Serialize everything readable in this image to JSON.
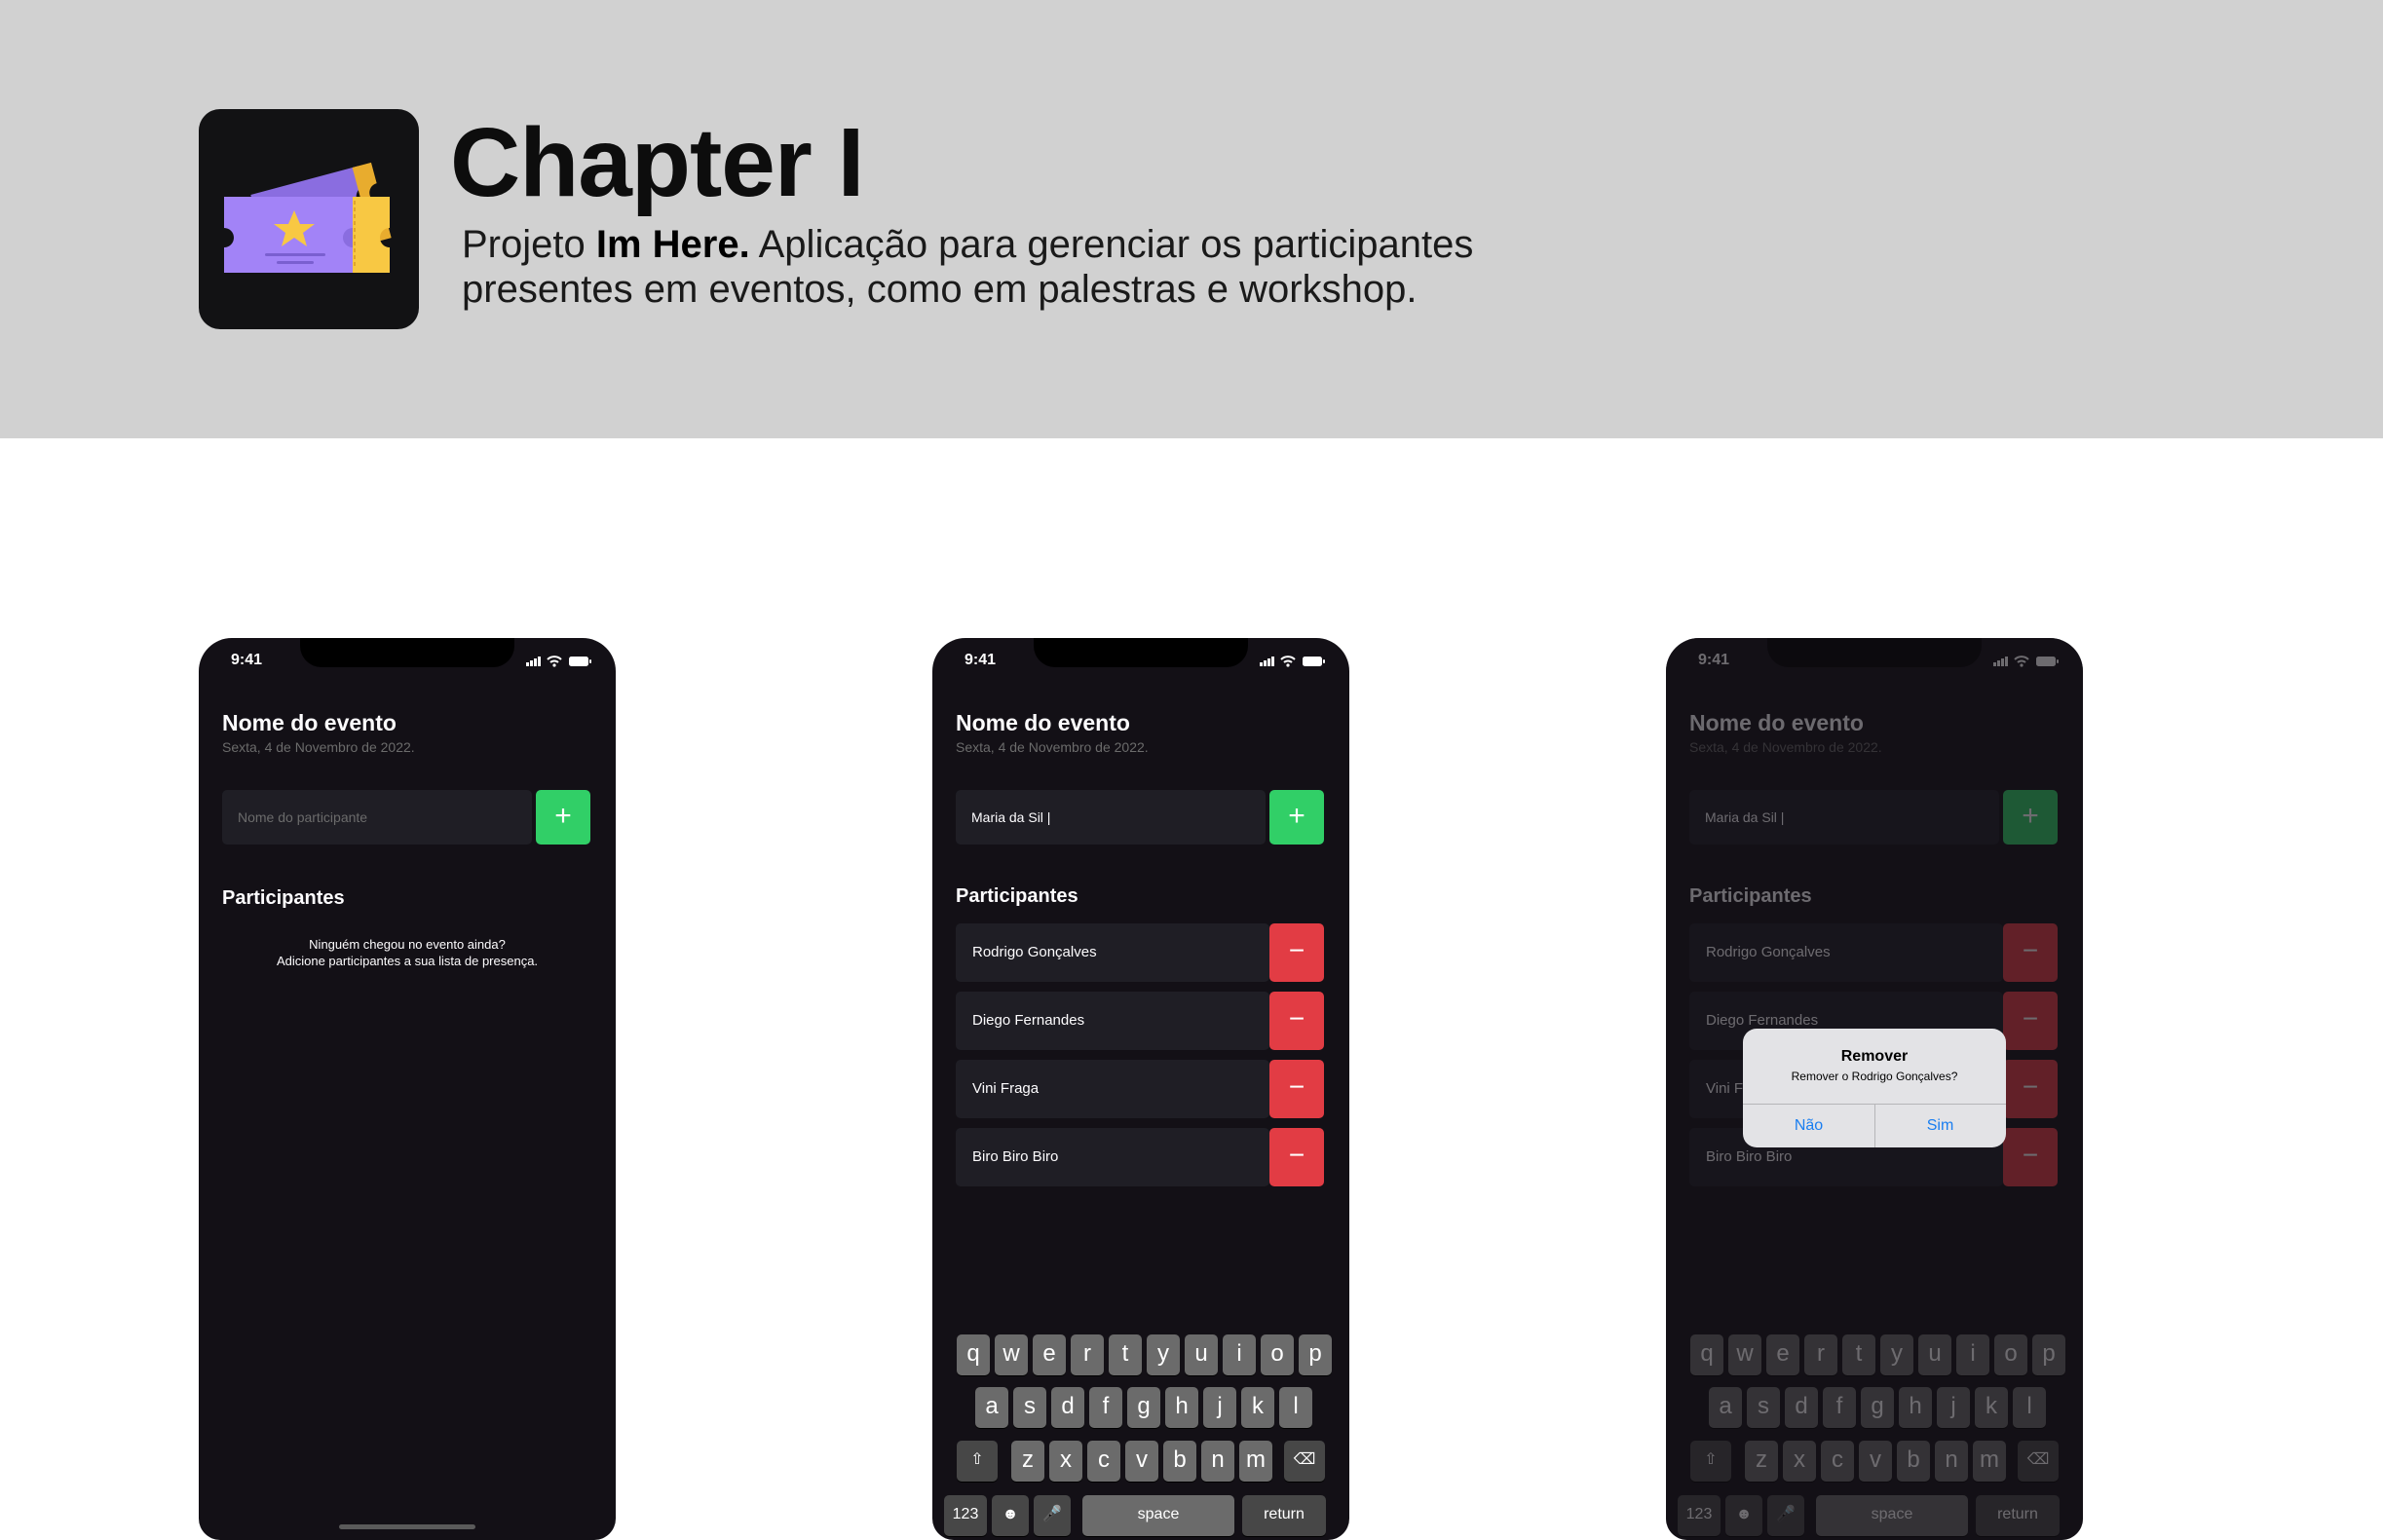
{
  "header": {
    "title": "Chapter I",
    "desc_prefix": "Projeto ",
    "desc_bold": "Im Here.",
    "desc_rest": " Aplicação para gerenciar os participantes presentes em eventos, como em palestras e workshop.",
    "icon": "ticket-icon",
    "colors": {
      "banner": "#d1d1d1",
      "icon_bg": "#121214",
      "ticket_purple": "#9b7cf0",
      "ticket_yellow": "#f8c843"
    }
  },
  "status": {
    "time": "9:41"
  },
  "event": {
    "title": "Nome do evento",
    "date": "Sexta, 4 de Novembro de 2022."
  },
  "input": {
    "placeholder": "Nome do participante",
    "value": "Maria da Sil |"
  },
  "buttons": {
    "add": "+",
    "remove": "−"
  },
  "section": {
    "participants": "Participantes"
  },
  "empty": {
    "line1": "Ninguém chegou no evento ainda?",
    "line2": "Adicione participantes a sua lista de presença."
  },
  "participants": [
    "Rodrigo Gonçalves",
    "Diego Fernandes",
    "Vini Fraga",
    "Biro Biro Biro"
  ],
  "keyboard": {
    "row1": [
      "q",
      "w",
      "e",
      "r",
      "t",
      "y",
      "u",
      "i",
      "o",
      "p"
    ],
    "row2": [
      "a",
      "s",
      "d",
      "f",
      "g",
      "h",
      "j",
      "k",
      "l"
    ],
    "row3": [
      "z",
      "x",
      "c",
      "v",
      "b",
      "n",
      "m"
    ],
    "shift": "⇧",
    "backspace": "⌫",
    "numbers": "123",
    "emoji": "☻",
    "mic": "🎤",
    "space": "space",
    "return": "return"
  },
  "alert": {
    "title": "Remover",
    "message": "Remover o Rodrigo Gonçalves?",
    "no": "Não",
    "yes": "Sim"
  },
  "theme": {
    "bg": "#131016",
    "field": "#1f1e25",
    "green": "#31cf67",
    "red": "#e23c44",
    "link": "#1a7ef0"
  }
}
